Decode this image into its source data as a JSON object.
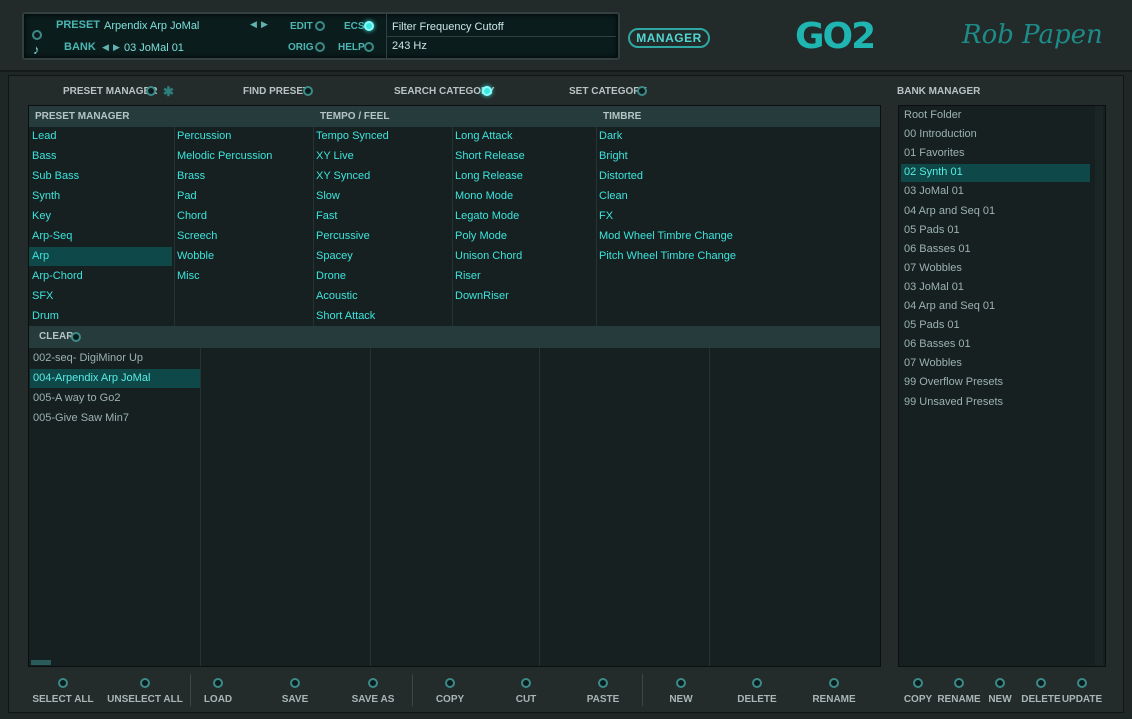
{
  "header": {
    "preset_label": "PRESET",
    "preset_name": "Arpendix Arp JoMal",
    "bank_label": "BANK",
    "bank_name": "03 JoMal 01",
    "edit_label": "EDIT",
    "orig_label": "ORIG",
    "ecs_label": "ECS",
    "help_label": "HELP",
    "param_name": "Filter Frequency Cutoff",
    "param_value": "243 Hz",
    "manager_button": "MANAGER",
    "logo": "GO2",
    "brand": "Rob Papen"
  },
  "sections": {
    "preset_manager": "PRESET MANAGER",
    "find_preset": "FIND PRESET",
    "search_category": "SEARCH CATEGORY",
    "set_category": "SET CATEGORY",
    "bank_manager": "BANK MANAGER"
  },
  "categories": {
    "col1_header": "PRESET MANAGER",
    "col3_header": "TEMPO / FEEL",
    "col5_header": "TIMBRE",
    "col1": [
      "Lead",
      "Bass",
      "Sub Bass",
      "Synth",
      "Key",
      "Arp-Seq",
      "Arp",
      "Arp-Chord",
      "SFX",
      "Drum"
    ],
    "col2": [
      "Percussion",
      "Melodic Percussion",
      "Brass",
      "Pad",
      "Chord",
      "Screech",
      "Wobble",
      "Misc"
    ],
    "col3": [
      "Tempo Synced",
      "XY Live",
      "XY Synced",
      "Slow",
      "Fast",
      "Percussive",
      "Spacey",
      "Drone",
      "Acoustic",
      "Short Attack"
    ],
    "col4": [
      "Long Attack",
      "Short Release",
      "Long Release",
      "Mono Mode",
      "Legato Mode",
      "Poly Mode",
      "Unison Chord",
      "Riser",
      "DownRiser"
    ],
    "col5": [
      "Dark",
      "Bright",
      "Distorted",
      "Clean",
      "FX",
      "Mod Wheel Timbre Change",
      "Pitch Wheel Timbre Change"
    ],
    "selected": "Arp"
  },
  "clear_label": "CLEAR",
  "presets": [
    "002-seq- DigiMinor Up",
    "004-Arpendix Arp JoMal",
    "005-A way to Go2",
    "005-Give Saw Min7"
  ],
  "selected_preset": "004-Arpendix Arp JoMal",
  "banks": [
    "Root Folder",
    "00 Introduction",
    "01 Favorites",
    "02 Synth 01",
    "03 JoMal 01",
    "04 Arp and Seq 01",
    "05 Pads 01",
    "06 Basses 01",
    "07 Wobbles",
    "03 JoMal 01",
    "04 Arp and Seq 01",
    "05 Pads 01",
    "06 Basses 01",
    "07 Wobbles",
    "99 Overflow Presets",
    "99 Unsaved Presets"
  ],
  "selected_bank": "02 Synth 01",
  "buttons": {
    "select_all": "SELECT ALL",
    "unselect_all": "UNSELECT ALL",
    "load": "LOAD",
    "save": "SAVE",
    "save_as": "SAVE AS",
    "copy": "COPY",
    "cut": "CUT",
    "paste": "PASTE",
    "new": "NEW",
    "delete": "DELETE",
    "rename": "RENAME"
  },
  "bank_buttons": {
    "copy": "COPY",
    "rename": "RENAME",
    "new": "NEW",
    "delete": "DELETE",
    "update": "UPDATE"
  }
}
